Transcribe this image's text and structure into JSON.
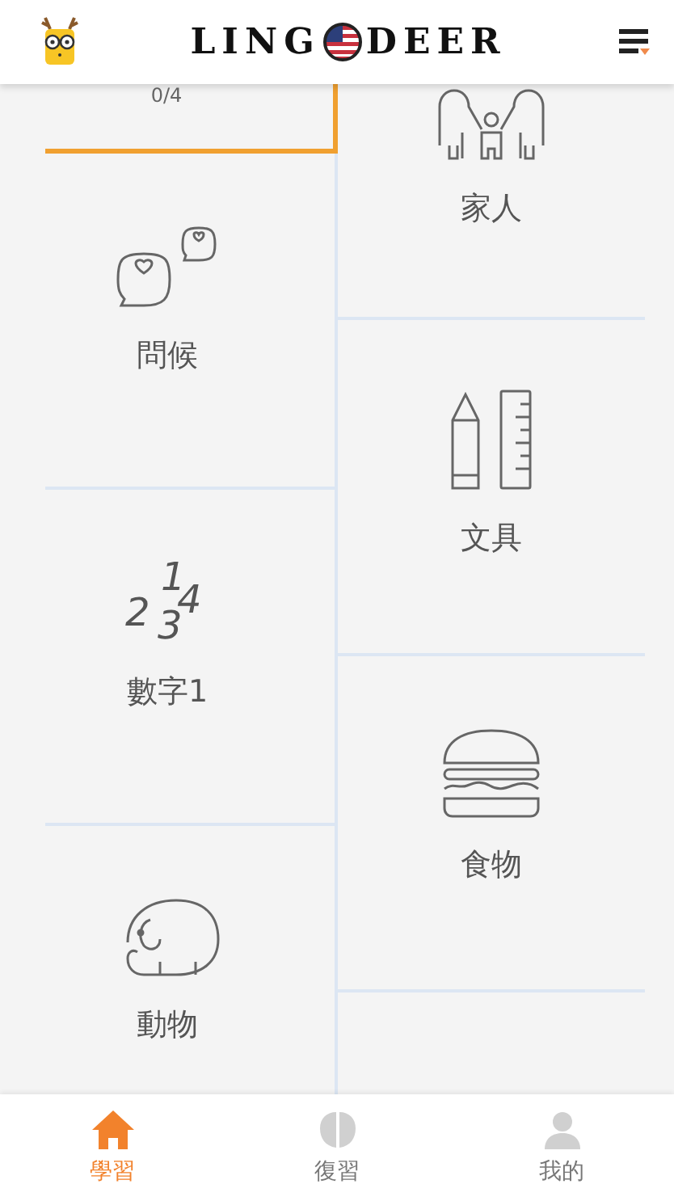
{
  "header": {
    "brand_start": "LING",
    "brand_end": "DEER"
  },
  "left_column": [
    {
      "progress": "0/4",
      "selected": true
    },
    {
      "title": "問候",
      "selected": false
    },
    {
      "title": "數字1",
      "selected": false,
      "numerals": [
        "1",
        "2",
        "4",
        "3"
      ]
    },
    {
      "title": "動物",
      "selected": false
    }
  ],
  "right_column": [
    {
      "title": "家人",
      "selected": false
    },
    {
      "title": "文具",
      "selected": false
    },
    {
      "title": "食物",
      "selected": false
    }
  ],
  "tabs": [
    {
      "label": "學習",
      "selected": true
    },
    {
      "label": "復習",
      "selected": false
    },
    {
      "label": "我的",
      "selected": false
    }
  ]
}
